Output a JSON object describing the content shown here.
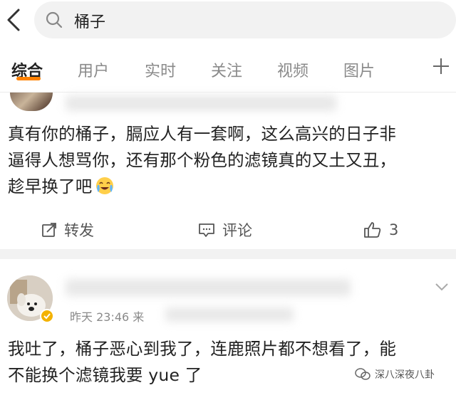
{
  "search": {
    "query": "桶子"
  },
  "tabs": [
    "综合",
    "用户",
    "实时",
    "关注",
    "视频",
    "图片"
  ],
  "post1": {
    "lines": [
      "真有你的桶子，膈应人有一套啊，这么高兴的日子非",
      "逼得人想骂你，还有那个粉色的滤镜真的又土又丑，",
      "趁早换了吧"
    ],
    "emoji": "crying-laughing-emoji",
    "actions": {
      "repost": "转发",
      "comment": "评论",
      "like_count": "3"
    }
  },
  "post2": {
    "time": "昨天 23:46",
    "source_prefix": "来",
    "lines": [
      "我吐了，桶子恶心到我了，连鹿照片都不想看了，能",
      "不能换个滤镜我要 yue 了"
    ]
  },
  "watermark": "深八深夜八卦",
  "colors": {
    "accent": "#ff8200",
    "verified": "#f3b200"
  }
}
